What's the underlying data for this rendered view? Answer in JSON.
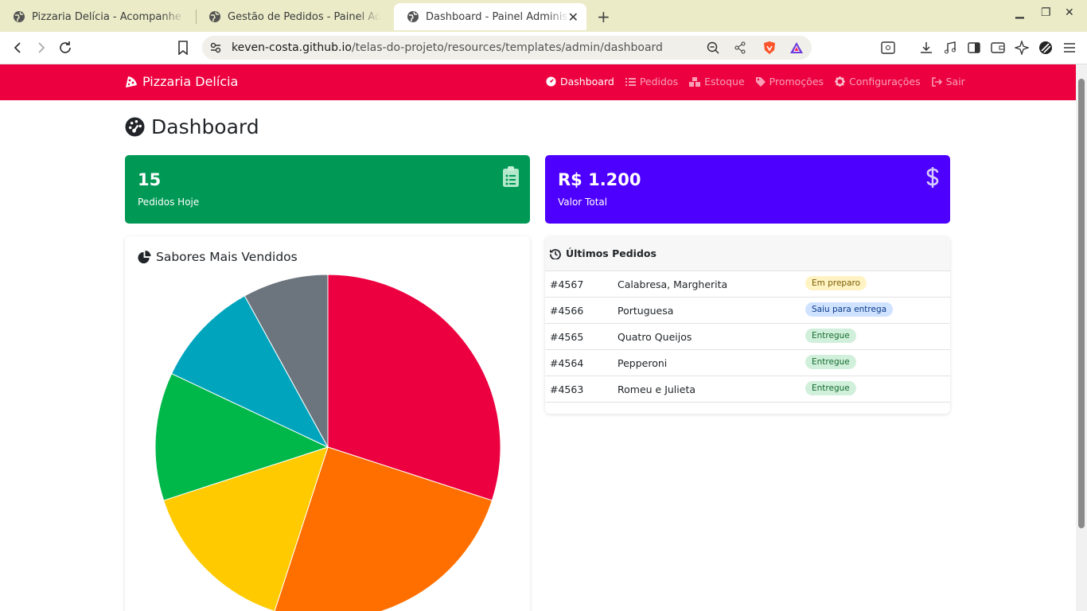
{
  "browser": {
    "tabs": [
      {
        "title": "Pizzaria Delícia - Acompanhe seu Pedido",
        "active": false
      },
      {
        "title": "Gestão de Pedidos - Painel Administrativo",
        "active": false
      },
      {
        "title": "Dashboard - Painel Administrativo",
        "active": true
      }
    ],
    "url_host": "keven-costa.github.io",
    "url_path": "/telas-do-projeto/resources/templates/admin/dashboard"
  },
  "navbar": {
    "brand": "Pizzaria Delícia",
    "links": [
      {
        "label": "Dashboard",
        "icon": "gauge-icon",
        "active": true
      },
      {
        "label": "Pedidos",
        "icon": "list-icon",
        "active": false
      },
      {
        "label": "Estoque",
        "icon": "boxes-icon",
        "active": false
      },
      {
        "label": "Promoções",
        "icon": "tag-icon",
        "active": false
      },
      {
        "label": "Configurações",
        "icon": "gear-icon",
        "active": false
      },
      {
        "label": "Sair",
        "icon": "sign-out-icon",
        "active": false
      }
    ],
    "color": "#ec003f"
  },
  "page": {
    "title": "Dashboard"
  },
  "stats": [
    {
      "value": "15",
      "label": "Pedidos Hoje",
      "icon": "clipboard-list-icon",
      "color": "#009855"
    },
    {
      "value": "R$ 1.200",
      "label": "Valor Total",
      "icon": "dollar-icon",
      "color": "#4e00ff"
    }
  ],
  "chart_card": {
    "title": "Sabores Mais Vendidos"
  },
  "chart_data": {
    "type": "pie",
    "title": "Sabores Mais Vendidos",
    "values": [
      30,
      25,
      15,
      12,
      10,
      8
    ],
    "colors": [
      "#ec003f",
      "#ff6f00",
      "#ffcb00",
      "#00b84a",
      "#00a5bd",
      "#6c757d"
    ]
  },
  "orders": {
    "title": "Últimos Pedidos",
    "rows": [
      {
        "id": "#4567",
        "items": "Calabresa, Margherita",
        "status": "Em preparo",
        "kind": "prep"
      },
      {
        "id": "#4566",
        "items": "Portuguesa",
        "status": "Saiu para entrega",
        "kind": "route"
      },
      {
        "id": "#4565",
        "items": "Quatro Queijos",
        "status": "Entregue",
        "kind": "done"
      },
      {
        "id": "#4564",
        "items": "Pepperoni",
        "status": "Entregue",
        "kind": "done"
      },
      {
        "id": "#4563",
        "items": "Romeu e Julieta",
        "status": "Entregue",
        "kind": "done"
      }
    ]
  }
}
